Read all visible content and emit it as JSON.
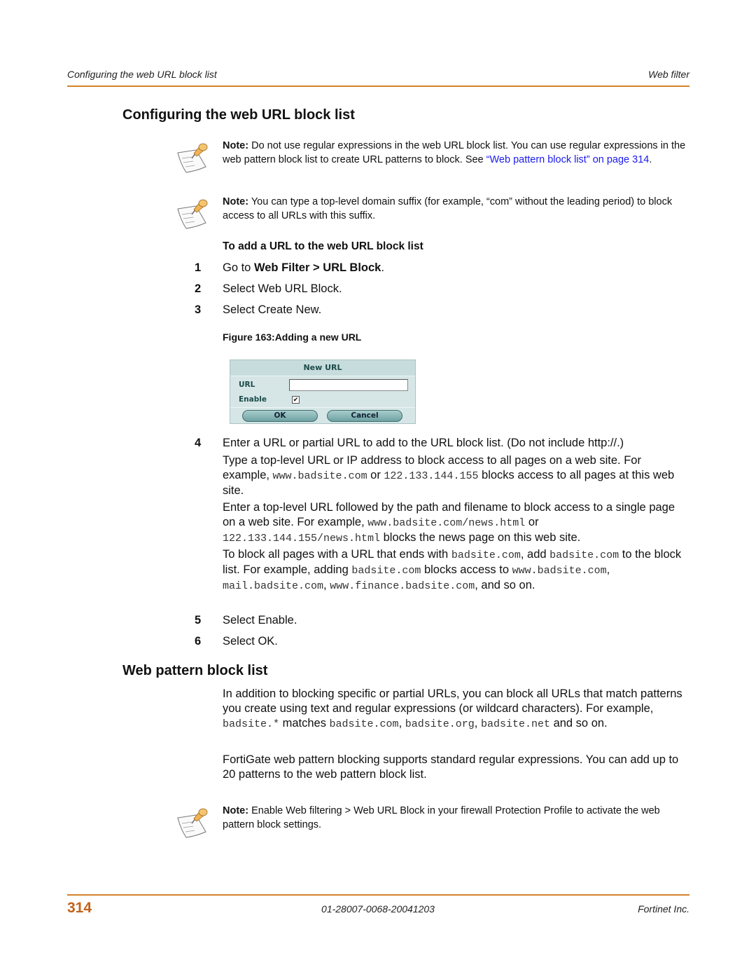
{
  "header": {
    "left": "Configuring the web URL block list",
    "right": "Web filter"
  },
  "colors": {
    "accent_rule": "#d2822a",
    "page_number": "#c2631a",
    "link": "#1a1aee"
  },
  "section1": {
    "title": "Configuring the web URL block list",
    "notes": [
      {
        "icon": "note-pushpin-icon",
        "label": "Note:",
        "text": " Do not use regular expressions in the web URL block list. You can use regular expressions in the web pattern block list to create URL patterns to block. See ",
        "link": "“Web pattern block list” on page 314",
        "after": "."
      },
      {
        "icon": "note-pushpin-icon",
        "label": "Note:",
        "text": " You can type a top-level domain suffix (for example, “com” without the leading period) to block access to all URLs with this suffix."
      }
    ],
    "procedure_title": "To add a URL to the web URL block list",
    "steps": [
      {
        "num": "1",
        "prefix": "Go to ",
        "bold": "Web Filter > URL Block",
        "suffix": "."
      },
      {
        "num": "2",
        "text": "Select Web URL Block."
      },
      {
        "num": "3",
        "text": "Select Create New."
      }
    ],
    "figure_caption": "Figure 163:Adding a new URL",
    "dialog": {
      "title": "New URL",
      "url_label": "URL",
      "url_value": "",
      "enable_label": "Enable",
      "enable_checked": true,
      "ok_label": "OK",
      "cancel_label": "Cancel"
    },
    "step4": {
      "num": "4",
      "text": "Enter a URL or partial URL to add to the URL block list. (Do not include http://.)",
      "p1": {
        "a": "Type a top-level URL or IP address to block access to all pages on a web site. For example, ",
        "code1": "www.badsite.com",
        "b": " or ",
        "code2": "122.133.144.155",
        "c": " blocks access to all pages at this web site."
      },
      "p2": {
        "a": "Enter a top-level URL followed by the path and filename to block access to a single page on a web site. For example, ",
        "code1": "www.badsite.com/news.html",
        "b": " or ",
        "code2": "122.133.144.155/news.html",
        "c": " blocks the news page on this web site."
      },
      "p3": {
        "a": "To block all pages with a URL that ends with ",
        "code1": "badsite.com",
        "b": ", add ",
        "code2": "badsite.com",
        "c": " to the block list. For example, adding ",
        "code3": "badsite.com",
        "d": " blocks access to ",
        "code4": "www.badsite.com",
        "e": ", ",
        "code5": "mail.badsite.com",
        "f": ", ",
        "code6": "www.finance.badsite.com",
        "g": ", and so on."
      }
    },
    "step5": {
      "num": "5",
      "text": "Select Enable."
    },
    "step6": {
      "num": "6",
      "text": "Select OK."
    }
  },
  "section2": {
    "title": "Web pattern block list",
    "p1": {
      "a": "In addition to blocking specific or partial URLs, you can block all URLs that match patterns you create using text and regular expressions (or wildcard characters). For example, ",
      "code1": "badsite.*",
      "b": " matches ",
      "code2": "badsite.com",
      "c": ", ",
      "code3": "badsite.org",
      "d": ", ",
      "code4": "badsite.net",
      "e": " and so on."
    },
    "p2": "FortiGate web pattern blocking supports standard regular expressions. You can add up to 20 patterns to the web pattern block list.",
    "note": {
      "icon": "note-pushpin-icon",
      "label": "Note:",
      "text": " Enable Web filtering > Web URL Block in your firewall Protection Profile to activate the web pattern block settings."
    }
  },
  "footer": {
    "page_number": "314",
    "doc_id": "01-28007-0068-20041203",
    "company": "Fortinet Inc."
  }
}
